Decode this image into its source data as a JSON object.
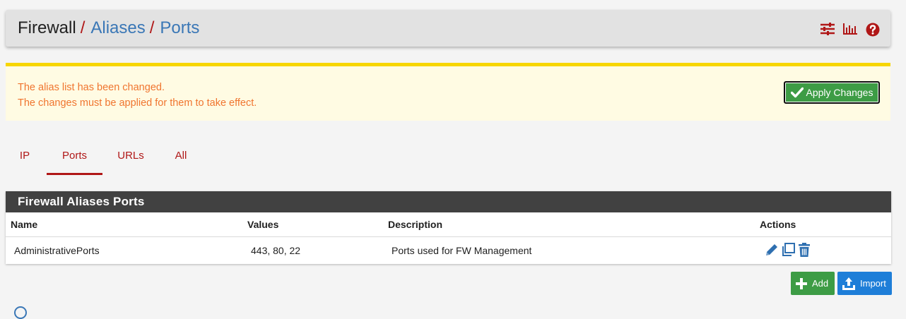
{
  "breadcrumb": {
    "items": [
      "Firewall",
      "Aliases",
      "Ports"
    ],
    "separator": "/"
  },
  "header_icons": [
    "sliders-icon",
    "bar-chart-icon",
    "help-icon"
  ],
  "alert": {
    "line1": "The alias list has been changed.",
    "line2": "The changes must be applied for them to take effect.",
    "apply_label": "Apply Changes"
  },
  "tabs": [
    {
      "label": "IP",
      "active": false
    },
    {
      "label": "Ports",
      "active": true
    },
    {
      "label": "URLs",
      "active": false
    },
    {
      "label": "All",
      "active": false
    }
  ],
  "panel": {
    "title": "Firewall Aliases Ports",
    "columns": [
      "Name",
      "Values",
      "Description",
      "Actions"
    ],
    "rows": [
      {
        "name": "AdministrativePorts",
        "values": "443, 80, 22",
        "description": "Ports used for FW Management"
      }
    ]
  },
  "buttons": {
    "add_label": "Add",
    "import_label": "Import"
  },
  "colors": {
    "accent_red": "#b01717",
    "link_blue": "#3a77b6",
    "success_green": "#3d9c45",
    "primary_blue": "#1e7ed8",
    "warning_text": "#f0752f",
    "warning_bg": "#fffbe3",
    "warning_border": "#f7d600"
  }
}
